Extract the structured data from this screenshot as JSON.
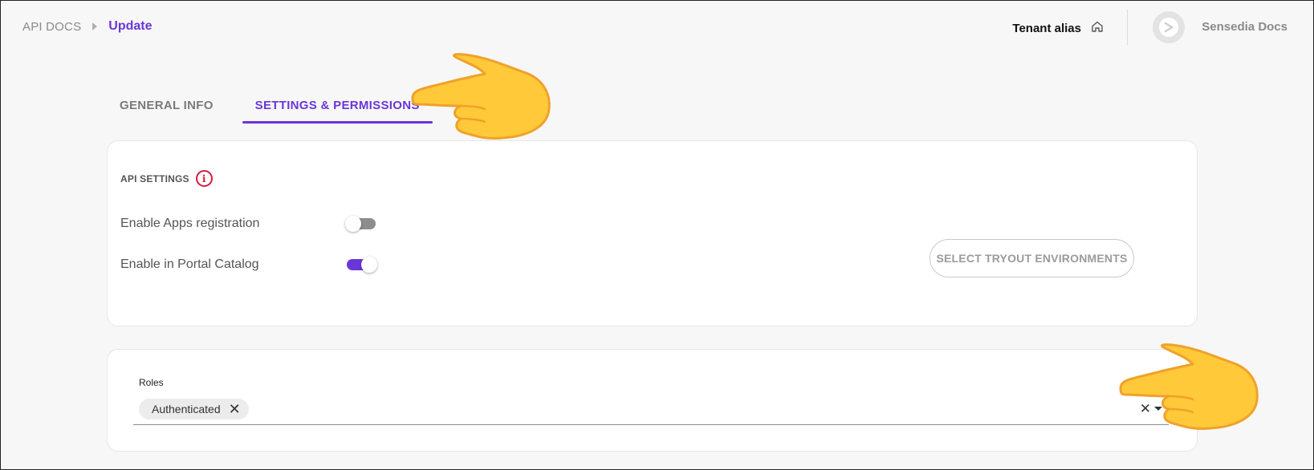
{
  "breadcrumb": {
    "root": "API DOCS",
    "current": "Update"
  },
  "header": {
    "tenant_label": "Tenant alias",
    "brand_name": "Sensedia Docs"
  },
  "tabs": [
    {
      "label": "GENERAL INFO",
      "active": false
    },
    {
      "label": "SETTINGS & PERMISSIONS",
      "active": true
    }
  ],
  "api_settings": {
    "title": "API SETTINGS",
    "toggles": [
      {
        "label": "Enable Apps registration",
        "enabled": false
      },
      {
        "label": "Enable in Portal Catalog",
        "enabled": true
      }
    ],
    "tryout_button": "SELECT TRYOUT ENVIRONMENTS"
  },
  "roles": {
    "label": "Roles",
    "selected": [
      "Authenticated"
    ]
  },
  "icons": {
    "home": "home-icon",
    "info": "info-icon",
    "chip_remove": "close-icon",
    "clear": "clear-icon",
    "dropdown": "caret-down-icon",
    "pointer": "pointing-hand-icon"
  },
  "colors": {
    "accent": "#6a36d9",
    "info": "#d31b3c",
    "toggle_off": "#8d8d8d"
  }
}
